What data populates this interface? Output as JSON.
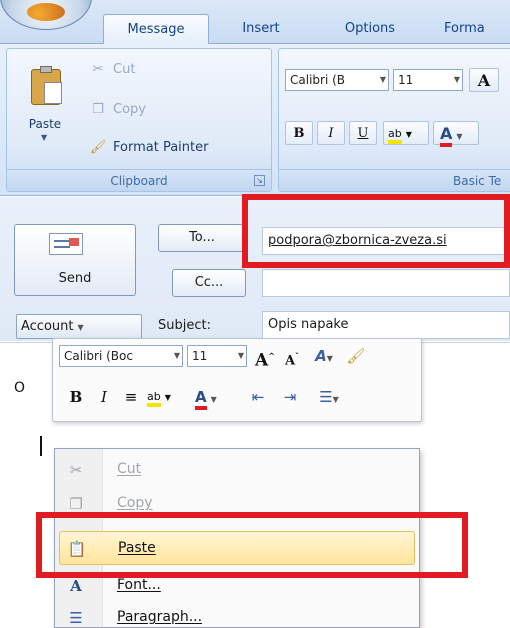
{
  "ribbon": {
    "tabs": [
      {
        "label": "Message",
        "active": true
      },
      {
        "label": "Insert"
      },
      {
        "label": "Options"
      },
      {
        "label": "Forma"
      }
    ],
    "clipboard": {
      "paste": "Paste",
      "cut": "Cut",
      "copy": "Copy",
      "format_painter": "Format Painter",
      "group_label": "Clipboard"
    },
    "basic_text": {
      "font": "Calibri (B",
      "size": "11",
      "grow_glyph": "A",
      "bold": "B",
      "italic": "I",
      "underline": "U",
      "highlight_glyph": "ab",
      "font_color_glyph": "A",
      "group_label": "Basic Te"
    }
  },
  "form": {
    "send_label": "Send",
    "to_label": "To...",
    "cc_label": "Cc...",
    "to_value": "podpora@zbornica-zveza.si",
    "account_label": "Account",
    "subject_label": "Subject:",
    "subject_value": "Opis napake",
    "body_text": "O"
  },
  "mini_toolbar": {
    "font": "Calibri (Boc",
    "size": "11",
    "grow_glyph": "A",
    "shrink_glyph": "A",
    "bold": "B",
    "italic": "I",
    "highlight_glyph": "ab",
    "font_color_glyph": "A"
  },
  "context_menu": {
    "items": [
      {
        "label": "Cut",
        "state": "disabled"
      },
      {
        "label": "Copy",
        "state": "disabled"
      },
      {
        "label": "Paste",
        "state": "hover"
      },
      {
        "label": "Font...",
        "state": "normal"
      },
      {
        "label": "Paragraph...",
        "state": "normal"
      }
    ]
  },
  "colors": {
    "highlight_box": "#e01b22",
    "menu_hover": "#ffe49c",
    "ribbon_text": "#15428b"
  },
  "icons": [
    "office-orb-icon",
    "clipboard-icon",
    "scissors-icon",
    "copy-icon",
    "paintbrush-icon",
    "send-envelope-icon",
    "dialog-launcher-icon",
    "text-effects-icon",
    "align-center-icon",
    "decrease-indent-icon",
    "increase-indent-icon",
    "bullets-icon"
  ]
}
